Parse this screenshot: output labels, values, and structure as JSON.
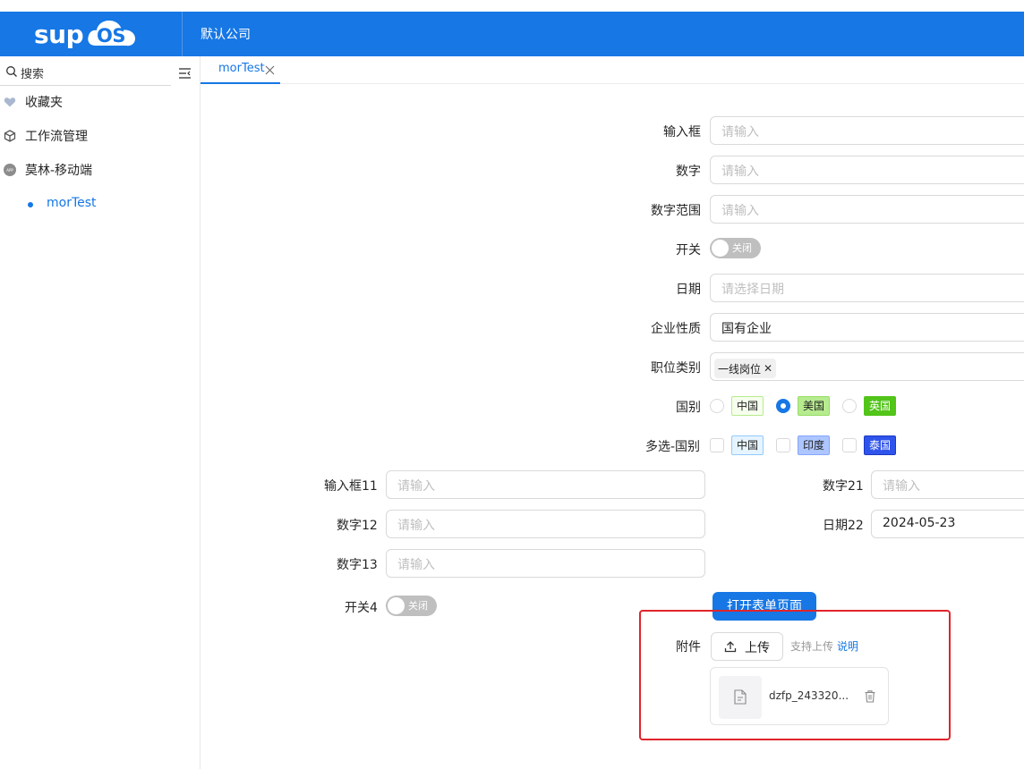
{
  "header": {
    "logo_text": "sup",
    "logo_os": "OS",
    "company": "默认公司"
  },
  "sidebar": {
    "search_label": "搜索",
    "items": [
      {
        "label": "收藏夹",
        "icon": "heart-icon"
      },
      {
        "label": "工作流管理",
        "icon": "cube-icon"
      },
      {
        "label": "莫林-移动端",
        "icon": "app-icon"
      }
    ],
    "sub_item": "morTest"
  },
  "tabs": [
    {
      "label": "morTest"
    }
  ],
  "form": {
    "input_label": "输入框",
    "input_placeholder": "请输入",
    "number_label": "数字",
    "number_placeholder": "请输入",
    "range_label": "数字范围",
    "range_placeholder": "请输入",
    "switch_label": "开关",
    "switch_text": "关闭",
    "date_label": "日期",
    "date_placeholder": "请选择日期",
    "nature_label": "企业性质",
    "nature_value": "国有企业",
    "job_label": "职位类别",
    "job_tag": "一线岗位",
    "country_label": "国别",
    "country_options": [
      {
        "label": "中国",
        "checked": false,
        "bg": "#f6ffed",
        "border": "#b7eb8f",
        "color": "#222"
      },
      {
        "label": "美国",
        "checked": true,
        "bg": "#b7eb8f",
        "border": "#95de64",
        "color": "#222"
      },
      {
        "label": "英国",
        "checked": false,
        "bg": "#52c41a",
        "border": "#52c41a",
        "color": "#fff"
      }
    ],
    "multi_label": "多选-国别",
    "multi_options": [
      {
        "label": "中国",
        "bg": "#e6f4ff",
        "border": "#91caff",
        "color": "#222"
      },
      {
        "label": "印度",
        "bg": "#adc6ff",
        "border": "#85a5ff",
        "color": "#222"
      },
      {
        "label": "泰国",
        "bg": "#2f54eb",
        "border": "#1d39c4",
        "color": "#fff"
      }
    ],
    "input11_label": "输入框11",
    "input11_placeholder": "请输入",
    "number21_label": "数字21",
    "number21_placeholder": "请输入",
    "number12_label": "数字12",
    "number12_placeholder": "请输入",
    "date22_label": "日期22",
    "date22_value": "2024-05-23",
    "number13_label": "数字13",
    "number13_placeholder": "请输入",
    "switch4_label": "开关4",
    "switch4_text": "关闭",
    "open_form_button": "打开表单页面",
    "attachment_label": "附件",
    "upload_button": "上传",
    "upload_hint": "支持上传",
    "upload_link": "说明",
    "file_name": "dzfp_243320..."
  }
}
